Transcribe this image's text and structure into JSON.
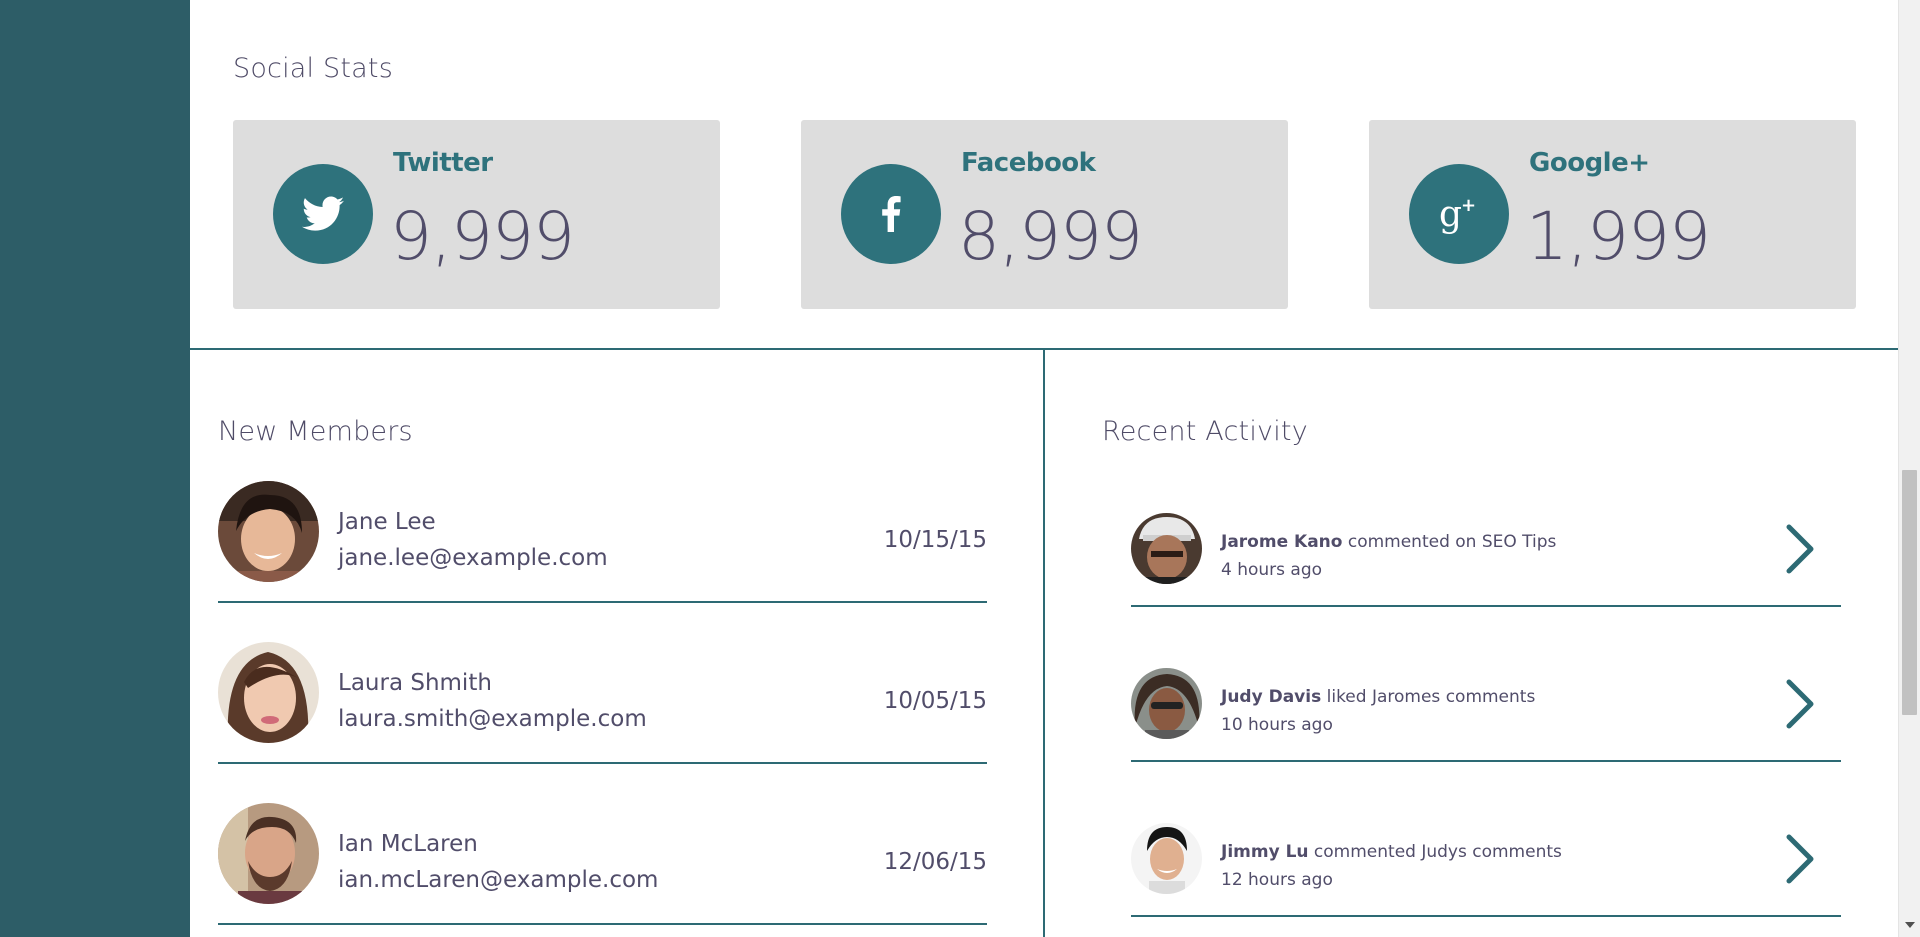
{
  "social_stats": {
    "title": "Social Stats",
    "cards": [
      {
        "name": "Twitter",
        "count": "9,999",
        "icon": "twitter-bird-icon"
      },
      {
        "name": "Facebook",
        "count": "8,999",
        "icon": "facebook-icon"
      },
      {
        "name": "Google+",
        "count": "1,999",
        "icon": "google-plus-icon"
      }
    ]
  },
  "new_members": {
    "title": "New Members",
    "items": [
      {
        "name": "Jane Lee",
        "email": "jane.lee@example.com",
        "date": "10/15/15"
      },
      {
        "name": "Laura Shmith",
        "email": "laura.smith@example.com",
        "date": "10/05/15"
      },
      {
        "name": "Ian McLaren",
        "email": "ian.mcLaren@example.com",
        "date": "12/06/15"
      }
    ]
  },
  "recent_activity": {
    "title": "Recent Activity",
    "items": [
      {
        "user": "Jarome Kano",
        "action": "commented on SEO Tips",
        "time": "4 hours ago"
      },
      {
        "user": "Judy Davis",
        "action": "liked Jaromes comments",
        "time": "10 hours ago"
      },
      {
        "user": "Jimmy Lu",
        "action": "commented Judys comments",
        "time": "12 hours ago"
      }
    ]
  },
  "colors": {
    "sidebar": "#2d5d67",
    "accent": "#2e727c",
    "card_bg": "#dddddd",
    "text": "#514d6a"
  }
}
